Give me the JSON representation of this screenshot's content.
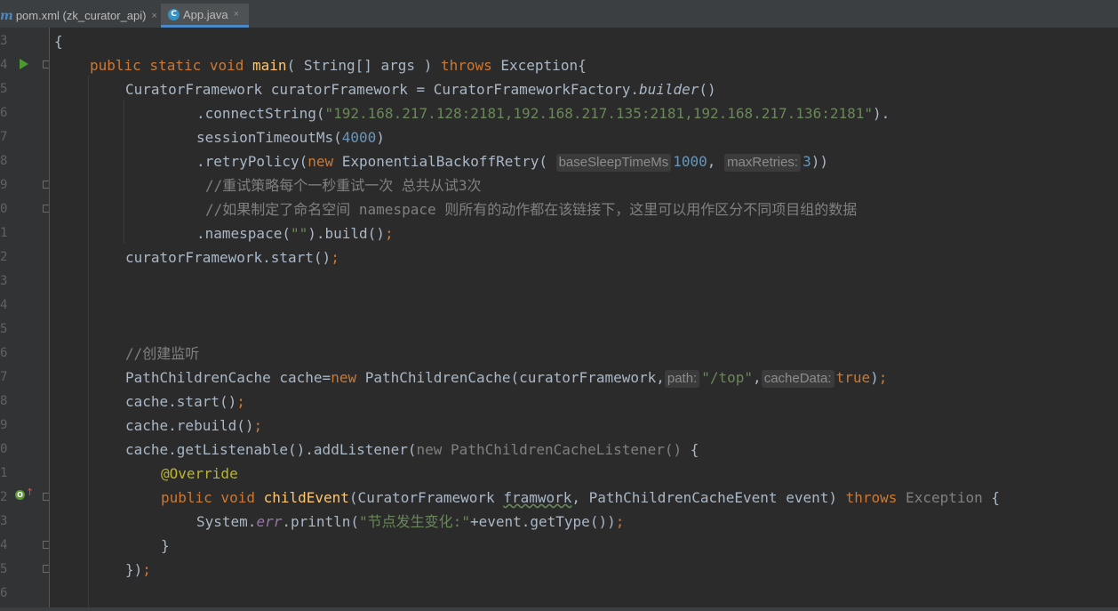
{
  "tabs": [
    {
      "label": "pom.xml (zk_curator_api)",
      "icon": "maven-m-icon",
      "close": "×"
    },
    {
      "label": "App.java",
      "icon": "java-class-icon",
      "icon_char": "C",
      "close": "×",
      "active": true
    }
  ],
  "gutter_numbers": [
    "3",
    "4",
    "5",
    "6",
    "7",
    "8",
    "9",
    "0",
    "1",
    "2",
    "3",
    "4",
    "5",
    "6",
    "7",
    "8",
    "9",
    "0",
    "1",
    "2",
    "3",
    "4",
    "5",
    "6"
  ],
  "code": {
    "l1": "{",
    "l2": {
      "k1": "public static void ",
      "fn": "main",
      "t1": "( String[] args ) ",
      "k2": "throws",
      "t2": " Exception{"
    },
    "l3": {
      "t1": "CuratorFramework curatorFramework = CuratorFrameworkFactory.",
      "it": "builder",
      "t2": "()"
    },
    "l4": {
      "t1": ".connectString(",
      "s": "\"192.168.217.128:2181,192.168.217.135:2181,192.168.217.136:2181\"",
      "t2": ")."
    },
    "l5": {
      "t1": "sessionTimeoutMs(",
      "n": "4000",
      "t2": ")"
    },
    "l6": {
      "t1": ".retryPolicy(",
      "k": "new",
      "t2": " ExponentialBackoffRetry( ",
      "h1": "baseSleepTimeMs",
      "n1": "1000",
      "t3": ", ",
      "h2": "maxRetries:",
      "n2": "3",
      "t4": "))"
    },
    "l7": "//重试策略每个一秒重试一次 总共从试3次",
    "l8": "//如果制定了命名空间 namespace 则所有的动作都在该链接下，这里可以用作区分不同项目组的数据",
    "l9": {
      "t1": ".namespace(",
      "s": "\"\"",
      "t2": ").build()",
      "semi": ";"
    },
    "l10": {
      "t1": "curatorFramework.start()",
      "semi": ";"
    },
    "l14": "//创建监听",
    "l15": {
      "t1": "PathChildrenCache cache=",
      "k": "new",
      "t2": " PathChildrenCache(curatorFramework,",
      "h1": "path:",
      "s": "\"/top\"",
      "t3": ",",
      "h2": "cacheData:",
      "k2": "true",
      "t4": ")",
      "semi": ";"
    },
    "l16": {
      "t1": "cache.start()",
      "semi": ";"
    },
    "l17": {
      "t1": "cache.rebuild()",
      "semi": ";"
    },
    "l18": {
      "t1": "cache.getListenable().addListener(",
      "g": "new PathChildrenCacheListener()",
      "t2": " {"
    },
    "l19": "@Override",
    "l20": {
      "k1": "public void ",
      "fn": "childEvent",
      "t1": "(CuratorFramework ",
      "sq": "framwork",
      "t2": ", PathChildrenCacheEvent event) ",
      "k2": "throws",
      "g": " Exception",
      "t3": " {"
    },
    "l21": {
      "t1": "System.",
      "err": "err",
      "t2": ".println(",
      "s": "\"节点发生变化:\"",
      "t3": "+event.getType())",
      "semi": ";"
    },
    "l22": "}",
    "l23": {
      "t1": "})",
      "semi": ";"
    }
  },
  "colors": {
    "background": "#2b2b2b",
    "keyword": "#cc7832",
    "string": "#6a8759",
    "number": "#6897bb",
    "comment": "#808080",
    "function": "#ffc66d",
    "annotation": "#bbb529"
  }
}
